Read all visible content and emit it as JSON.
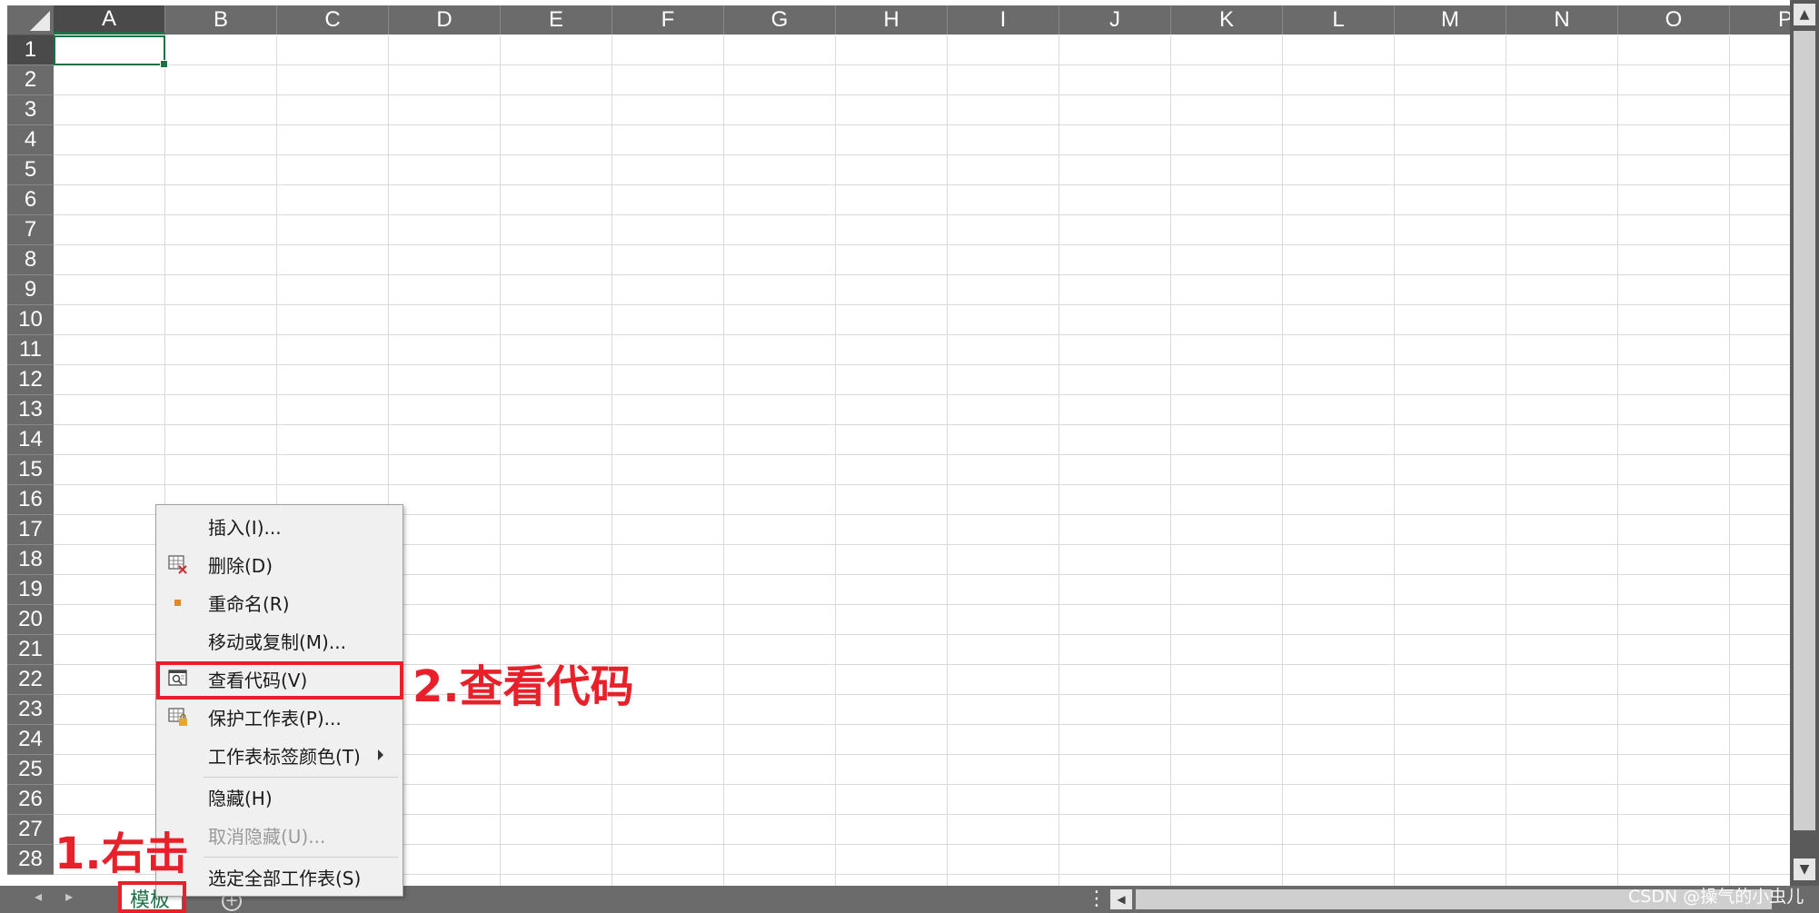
{
  "columns": [
    "A",
    "B",
    "C",
    "D",
    "E",
    "F",
    "G",
    "H",
    "I",
    "J",
    "K",
    "L",
    "M",
    "N",
    "O",
    "P"
  ],
  "rows": [
    "1",
    "2",
    "3",
    "4",
    "5",
    "6",
    "7",
    "8",
    "9",
    "10",
    "11",
    "12",
    "13",
    "14",
    "15",
    "16",
    "17",
    "18",
    "19",
    "20",
    "21",
    "22",
    "23",
    "24",
    "25",
    "26",
    "27",
    "28"
  ],
  "active_cell": {
    "column": "A",
    "row": "1"
  },
  "sheet_tabs": [
    {
      "label": "模板",
      "active": true
    }
  ],
  "context_menu": {
    "items": [
      {
        "label": "插入(I)...",
        "icon": null,
        "enabled": true
      },
      {
        "label": "删除(D)",
        "icon": "delete-sheet-icon",
        "enabled": true
      },
      {
        "label": "重命名(R)",
        "icon": "rename-dot-icon",
        "enabled": true
      },
      {
        "label": "移动或复制(M)...",
        "icon": null,
        "enabled": true
      },
      {
        "label": "查看代码(V)",
        "icon": "view-code-icon",
        "enabled": true
      },
      {
        "label": "保护工作表(P)...",
        "icon": "protect-sheet-icon",
        "enabled": true
      },
      {
        "label": "工作表标签颜色(T)",
        "icon": null,
        "enabled": true,
        "submenu": true
      },
      {
        "label": "隐藏(H)",
        "icon": null,
        "enabled": true
      },
      {
        "label": "取消隐藏(U)...",
        "icon": null,
        "enabled": false
      },
      {
        "label": "选定全部工作表(S)",
        "icon": null,
        "enabled": true
      }
    ]
  },
  "annotations": {
    "step1": "1.右击",
    "step2": "2.查看代码",
    "color": "#e8202a"
  },
  "watermark": "CSDN @操气的小虫儿",
  "colors": {
    "header_bg": "#6b6b6b",
    "accent_green": "#1e7145",
    "menu_bg": "#f0f0f0"
  }
}
